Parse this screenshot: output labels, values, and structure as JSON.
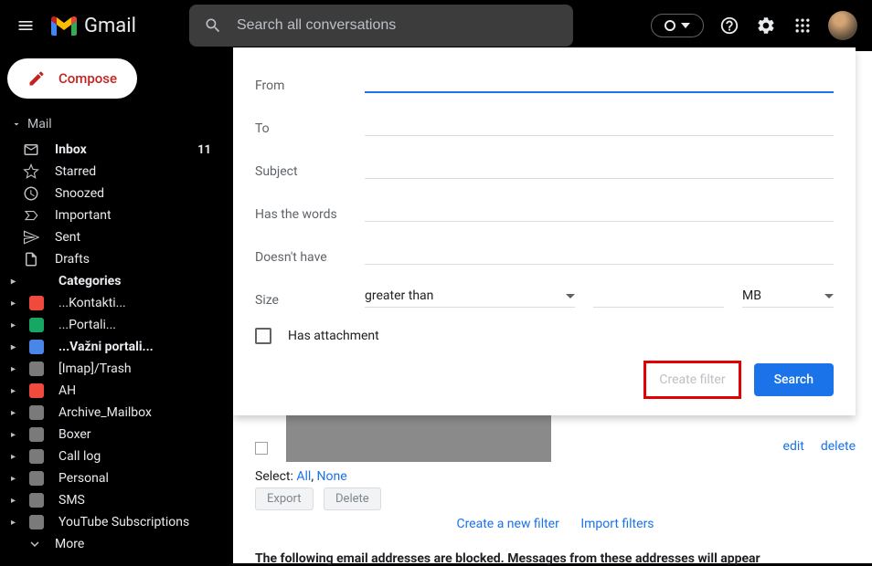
{
  "header": {
    "app_name": "Gmail",
    "search_placeholder": "Search all conversations"
  },
  "sidebar": {
    "compose_label": "Compose",
    "section_label": "Mail",
    "nav": [
      {
        "label": "Inbox",
        "count": "11",
        "bold": true
      },
      {
        "label": "Starred"
      },
      {
        "label": "Snoozed"
      },
      {
        "label": "Important"
      },
      {
        "label": "Sent"
      },
      {
        "label": "Drafts"
      },
      {
        "label": "Categories",
        "bold": true
      }
    ],
    "labels": [
      {
        "label": "...Kontakti...",
        "color": "#f04a3e"
      },
      {
        "label": "...Portali...",
        "color": "#16a765"
      },
      {
        "label": "...Važni portali...",
        "color": "#4986e7",
        "bold": true
      },
      {
        "label": "[Imap]/Trash",
        "color": "#7a7a7a"
      },
      {
        "label": "AH",
        "color": "#f04a3e"
      },
      {
        "label": "Archive_Mailbox",
        "color": "#7a7a7a"
      },
      {
        "label": "Boxer",
        "color": "#7a7a7a"
      },
      {
        "label": "Call log",
        "color": "#7a7a7a"
      },
      {
        "label": "Personal",
        "color": "#7a7a7a"
      },
      {
        "label": "SMS",
        "color": "#7a7a7a"
      },
      {
        "label": "YouTube Subscriptions",
        "color": "#7a7a7a"
      }
    ],
    "more_label": "More"
  },
  "search_panel": {
    "from_label": "From",
    "to_label": "To",
    "subject_label": "Subject",
    "has_words_label": "Has the words",
    "doesnt_have_label": "Doesn't have",
    "size_label": "Size",
    "size_op": "greater than",
    "size_unit": "MB",
    "has_attachment_label": "Has attachment",
    "create_filter_label": "Create filter",
    "search_label": "Search"
  },
  "content": {
    "edit_label": "edit",
    "delete_label": "delete",
    "select_label": "Select:",
    "all_label": "All",
    "none_label": "None",
    "export_label": "Export",
    "delete_btn_label": "Delete",
    "create_new_filter_label": "Create a new filter",
    "import_filters_label": "Import filters",
    "blocked_text": "The following email addresses are blocked. Messages from these addresses will appear"
  }
}
